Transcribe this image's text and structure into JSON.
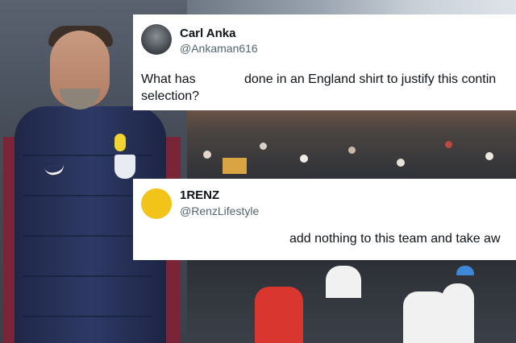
{
  "tweets": [
    {
      "display_name": "Carl Anka",
      "handle": "@Ankaman616",
      "text_part1": "What has",
      "text_part2": "done in an England shirt to justify this contin",
      "text_line2": "selection?"
    },
    {
      "display_name": "1RENZ",
      "handle": "@RenzLifestyle",
      "text": "add nothing to this team and take aw"
    }
  ],
  "colors": {
    "tweet_bg": "#ffffff",
    "name_text": "#0f1419",
    "handle_text": "#536471",
    "vest_navy": "#2e3a66",
    "shirt_red": "#d8362e"
  }
}
